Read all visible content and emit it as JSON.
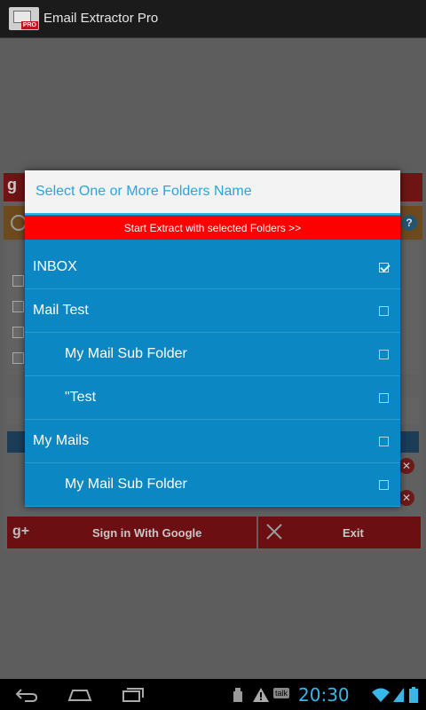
{
  "app": {
    "title": "Email Extractor Pro",
    "icon_badge": "PRO"
  },
  "main": {
    "sign_in_label": "Sign in With Google",
    "exit_label": "Exit",
    "help_glyph": "?"
  },
  "dialog": {
    "title": "Select One or More Folders Name",
    "extract_button": "Start Extract with selected Folders >>",
    "folders": [
      {
        "name": "INBOX",
        "checked": true,
        "indent": false
      },
      {
        "name": "Mail Test",
        "checked": false,
        "indent": false
      },
      {
        "name": "My Mail Sub Folder",
        "checked": false,
        "indent": true
      },
      {
        "name": "\"Test",
        "checked": false,
        "indent": true
      },
      {
        "name": "My Mails",
        "checked": false,
        "indent": false
      },
      {
        "name": "My Mail Sub Folder",
        "checked": false,
        "indent": true
      }
    ]
  },
  "status_bar": {
    "time": "20:30",
    "talk_label": "talk"
  },
  "colors": {
    "dialog_blue": "#0b87c3",
    "accent_red": "#ff0000",
    "title_blue": "#2aa4dc",
    "clock_blue": "#38b7ea"
  }
}
